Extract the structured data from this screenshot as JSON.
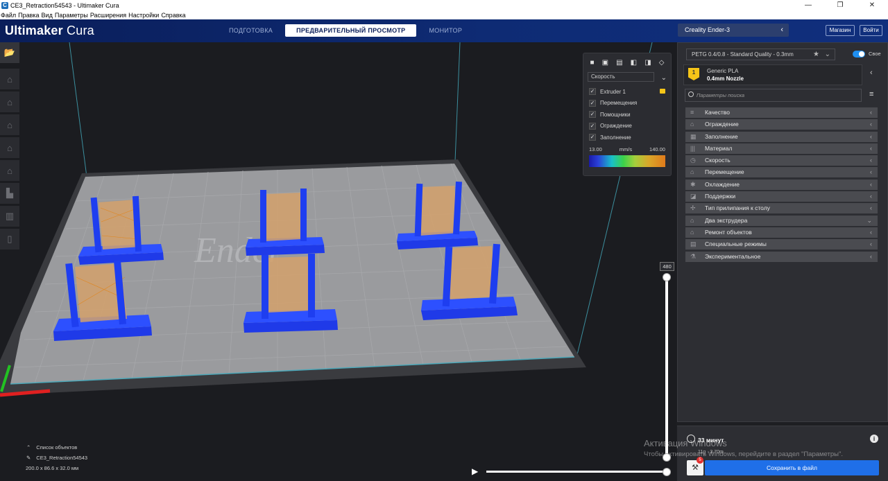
{
  "window": {
    "title": "CE3_Retraction54543 - Ultimaker Cura",
    "controls": [
      "—",
      "❐",
      "✕"
    ]
  },
  "menu": [
    "Файл",
    "Правка",
    "Вид",
    "Параметры",
    "Расширения",
    "Настройки",
    "Справка"
  ],
  "header": {
    "logo_strong": "Ultimaker",
    "logo_light": "Cura",
    "tabs": [
      "ПОДГОТОВКА",
      "ПРЕДВАРИТЕЛЬНЫЙ ПРОСМОТР",
      "МОНИТОР"
    ],
    "active_tab": 1,
    "printer": "Creality Ender-3",
    "marketplace": "Магазин",
    "signin": "Войти"
  },
  "view_panel": {
    "color_scheme": "Скорость",
    "items": [
      "Extruder 1",
      "Перемещения",
      "Помощники",
      "Ограждение",
      "Заполнение"
    ],
    "min": "13.00",
    "unit": "mm/s",
    "max": "140.00"
  },
  "layer_slider": {
    "value": "480"
  },
  "object_list": {
    "title": "Список объектов",
    "object": "CE3_Retraction54543",
    "size": "200.0 x 86.6 x 32.0 мм"
  },
  "settings": {
    "profile": "PETG 0.4/0.8 - Standard Quality - 0.3mm",
    "custom_label": "Свое",
    "extruder_number": "1",
    "material": "Generic PLA",
    "nozzle": "0.4mm Nozzle",
    "search_placeholder": "Параметры поиска",
    "categories": [
      {
        "label": "Качество",
        "icon": "≡",
        "open": false
      },
      {
        "label": "Ограждение",
        "icon": "⌂",
        "open": false
      },
      {
        "label": "Заполнение",
        "icon": "▦",
        "open": false
      },
      {
        "label": "Материал",
        "icon": "|||",
        "open": false
      },
      {
        "label": "Скорость",
        "icon": "◷",
        "open": false
      },
      {
        "label": "Перемещение",
        "icon": "⌂",
        "open": false
      },
      {
        "label": "Охлаждение",
        "icon": "✱",
        "open": false
      },
      {
        "label": "Поддержки",
        "icon": "◪",
        "open": false
      },
      {
        "label": "Тип прилипания к столу",
        "icon": "✢",
        "open": false
      },
      {
        "label": "Два экструдера",
        "icon": "⌂",
        "open": true
      },
      {
        "label": "Ремонт объектов",
        "icon": "⌂",
        "open": false
      },
      {
        "label": "Специальные режимы",
        "icon": "▤",
        "open": false
      },
      {
        "label": "Экспериментальное",
        "icon": "⚗",
        "open": false
      }
    ]
  },
  "action": {
    "time": "33 минут",
    "weight": "11g · 3.70m",
    "badge": "5",
    "save": "Сохранить в файл"
  },
  "watermark": {
    "title": "Активация Windows",
    "text": "Чтобы активировать Windows, перейдите в раздел \"Параметры\"."
  },
  "colors": {
    "header_bg": "#0e2b74",
    "accent_blue": "#1f6fe8",
    "model_blue": "#1e3ef0",
    "infill_orange": "#e0851c",
    "extruder_yellow": "#f5c518"
  }
}
